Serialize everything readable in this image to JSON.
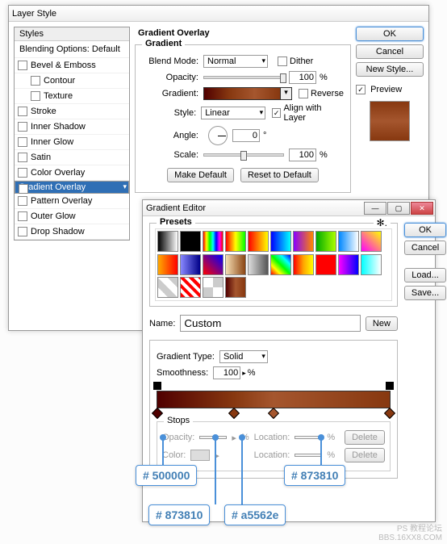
{
  "layerStyle": {
    "title": "Layer Style",
    "stylesHeader": "Styles",
    "blendingOptions": "Blending Options: Default",
    "items": [
      {
        "label": "Bevel & Emboss",
        "checked": false
      },
      {
        "label": "Contour",
        "checked": false,
        "indent": true
      },
      {
        "label": "Texture",
        "checked": false,
        "indent": true
      },
      {
        "label": "Stroke",
        "checked": false
      },
      {
        "label": "Inner Shadow",
        "checked": false
      },
      {
        "label": "Inner Glow",
        "checked": false
      },
      {
        "label": "Satin",
        "checked": false
      },
      {
        "label": "Color Overlay",
        "checked": false
      },
      {
        "label": "Gradient Overlay",
        "checked": true,
        "selected": true
      },
      {
        "label": "Pattern Overlay",
        "checked": false
      },
      {
        "label": "Outer Glow",
        "checked": false
      },
      {
        "label": "Drop Shadow",
        "checked": false
      }
    ],
    "section": {
      "title": "Gradient Overlay",
      "subtitle": "Gradient",
      "blendModeLabel": "Blend Mode:",
      "blendMode": "Normal",
      "ditherLabel": "Dither",
      "dither": false,
      "opacityLabel": "Opacity:",
      "opacity": "100",
      "pct": "%",
      "gradientLabel": "Gradient:",
      "reverseLabel": "Reverse",
      "reverse": false,
      "styleLabel": "Style:",
      "style": "Linear",
      "alignLabel": "Align with Layer",
      "align": true,
      "angleLabel": "Angle:",
      "angle": "0",
      "deg": "°",
      "scaleLabel": "Scale:",
      "scale": "100",
      "makeDefault": "Make Default",
      "resetDefault": "Reset to Default"
    },
    "buttons": {
      "ok": "OK",
      "cancel": "Cancel",
      "newStyle": "New Style...",
      "previewLabel": "Preview",
      "preview": true
    }
  },
  "gradientEditor": {
    "title": "Gradient Editor",
    "presetsLabel": "Presets",
    "presets": [
      "linear-gradient(90deg,#000,#fff)",
      "#000",
      "linear-gradient(90deg,red,yellow,lime,cyan,blue,magenta,red)",
      "linear-gradient(90deg,red,yellow,lime)",
      "linear-gradient(90deg,#f00,#ff0)",
      "linear-gradient(90deg,#00f,#0ff)",
      "linear-gradient(90deg,#80f,#f80)",
      "linear-gradient(90deg,#0a0,#af0)",
      "linear-gradient(90deg,#08f,#fff)",
      "linear-gradient(45deg,#f0f,#ff0)",
      "linear-gradient(90deg,#fa0,#f00)",
      "linear-gradient(90deg,#88f,#008)",
      "linear-gradient(45deg,#f00,#00f)",
      "linear-gradient(90deg,#f5deb3,#8b4513)",
      "linear-gradient(90deg,#ddd,#555)",
      "linear-gradient(45deg,red,yellow,lime,cyan,blue)",
      "linear-gradient(90deg,red,orange,yellow)",
      "#f00",
      "linear-gradient(90deg,#f0f,#00f)",
      "linear-gradient(90deg,#0ff,#fff)",
      "linear-gradient(45deg,#fff 25%,#ccc 25%,#ccc 50%,#fff 50%,#fff 75%,#ccc 75%)",
      "repeating-linear-gradient(45deg,#f00 0 4px,#fff 4px 8px)",
      "repeating-conic-gradient(#ccc 0 25%,#fff 0 50%)",
      "linear-gradient(90deg,#500000,#a5562e,#873810)"
    ],
    "nameLabel": "Name:",
    "name": "Custom",
    "newBtn": "New",
    "typeLabel": "Gradient Type:",
    "type": "Solid",
    "smoothLabel": "Smoothness:",
    "smooth": "100",
    "pct": "%",
    "opacityStops": [
      0,
      100
    ],
    "colorStops": [
      {
        "pos": 0,
        "color": "#500000"
      },
      {
        "pos": 33,
        "color": "#873810"
      },
      {
        "pos": 50,
        "color": "#a5562e"
      },
      {
        "pos": 100,
        "color": "#873810"
      }
    ],
    "stopsLabel": "Stops",
    "stopOpacityLabel": "Opacity:",
    "stopColorLabel": "Color:",
    "locationLabel": "Location:",
    "delete": "Delete",
    "buttons": {
      "ok": "OK",
      "cancel": "Cancel",
      "load": "Load...",
      "save": "Save..."
    }
  },
  "callouts": {
    "c1": "# 500000",
    "c2": "# 873810",
    "c3": "# a5562e",
    "c4": "# 873810"
  },
  "watermark": {
    "l1": "PS 教程论坛",
    "l2": "BBS.16XX8.COM"
  }
}
